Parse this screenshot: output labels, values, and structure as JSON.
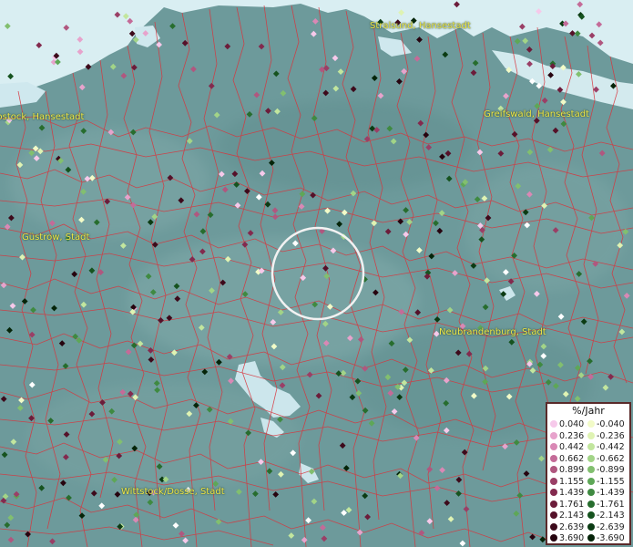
{
  "map": {
    "cities": [
      {
        "name": "Stralsund, Hansestadt"
      },
      {
        "name": "Rostock, Hansestadt"
      },
      {
        "name": "Greifswald, Hansestadt"
      },
      {
        "name": "Güstrow, Stadt"
      },
      {
        "name": "Neubrandenburg, Stadt"
      },
      {
        "name": "Wittstock/Dosse, Stadt"
      }
    ],
    "colors": {
      "land": "#6d9a9b",
      "water": "#d8eef2",
      "borders": "#d8343c"
    }
  },
  "legend": {
    "title": "%/Jahr",
    "positive": [
      {
        "label": "0.040",
        "color": "#f6c9ea"
      },
      {
        "label": "0.236",
        "color": "#e7a3cc"
      },
      {
        "label": "0.442",
        "color": "#d988b5"
      },
      {
        "label": "0.662",
        "color": "#c46b98"
      },
      {
        "label": "0.899",
        "color": "#b0577f"
      },
      {
        "label": "1.155",
        "color": "#9a3f66"
      },
      {
        "label": "1.439",
        "color": "#832a4e"
      },
      {
        "label": "1.761",
        "color": "#6c1c3a"
      },
      {
        "label": "2.143",
        "color": "#551129"
      },
      {
        "label": "2.639",
        "color": "#3d0a1b"
      },
      {
        "label": "3.690",
        "color": "#26040f"
      }
    ],
    "negative": [
      {
        "label": "-0.040",
        "color": "#f2fbc8"
      },
      {
        "label": "-0.236",
        "color": "#dff3b3"
      },
      {
        "label": "-0.442",
        "color": "#c2e69e"
      },
      {
        "label": "-0.662",
        "color": "#a2d487"
      },
      {
        "label": "-0.899",
        "color": "#82bf6f"
      },
      {
        "label": "-1.155",
        "color": "#5ea757"
      },
      {
        "label": "-1.439",
        "color": "#3f8a41"
      },
      {
        "label": "-1.761",
        "color": "#276d2e"
      },
      {
        "label": "-2.143",
        "color": "#16531f"
      },
      {
        "label": "-2.639",
        "color": "#0b3b13"
      },
      {
        "label": "-3.690",
        "color": "#052409"
      }
    ]
  }
}
